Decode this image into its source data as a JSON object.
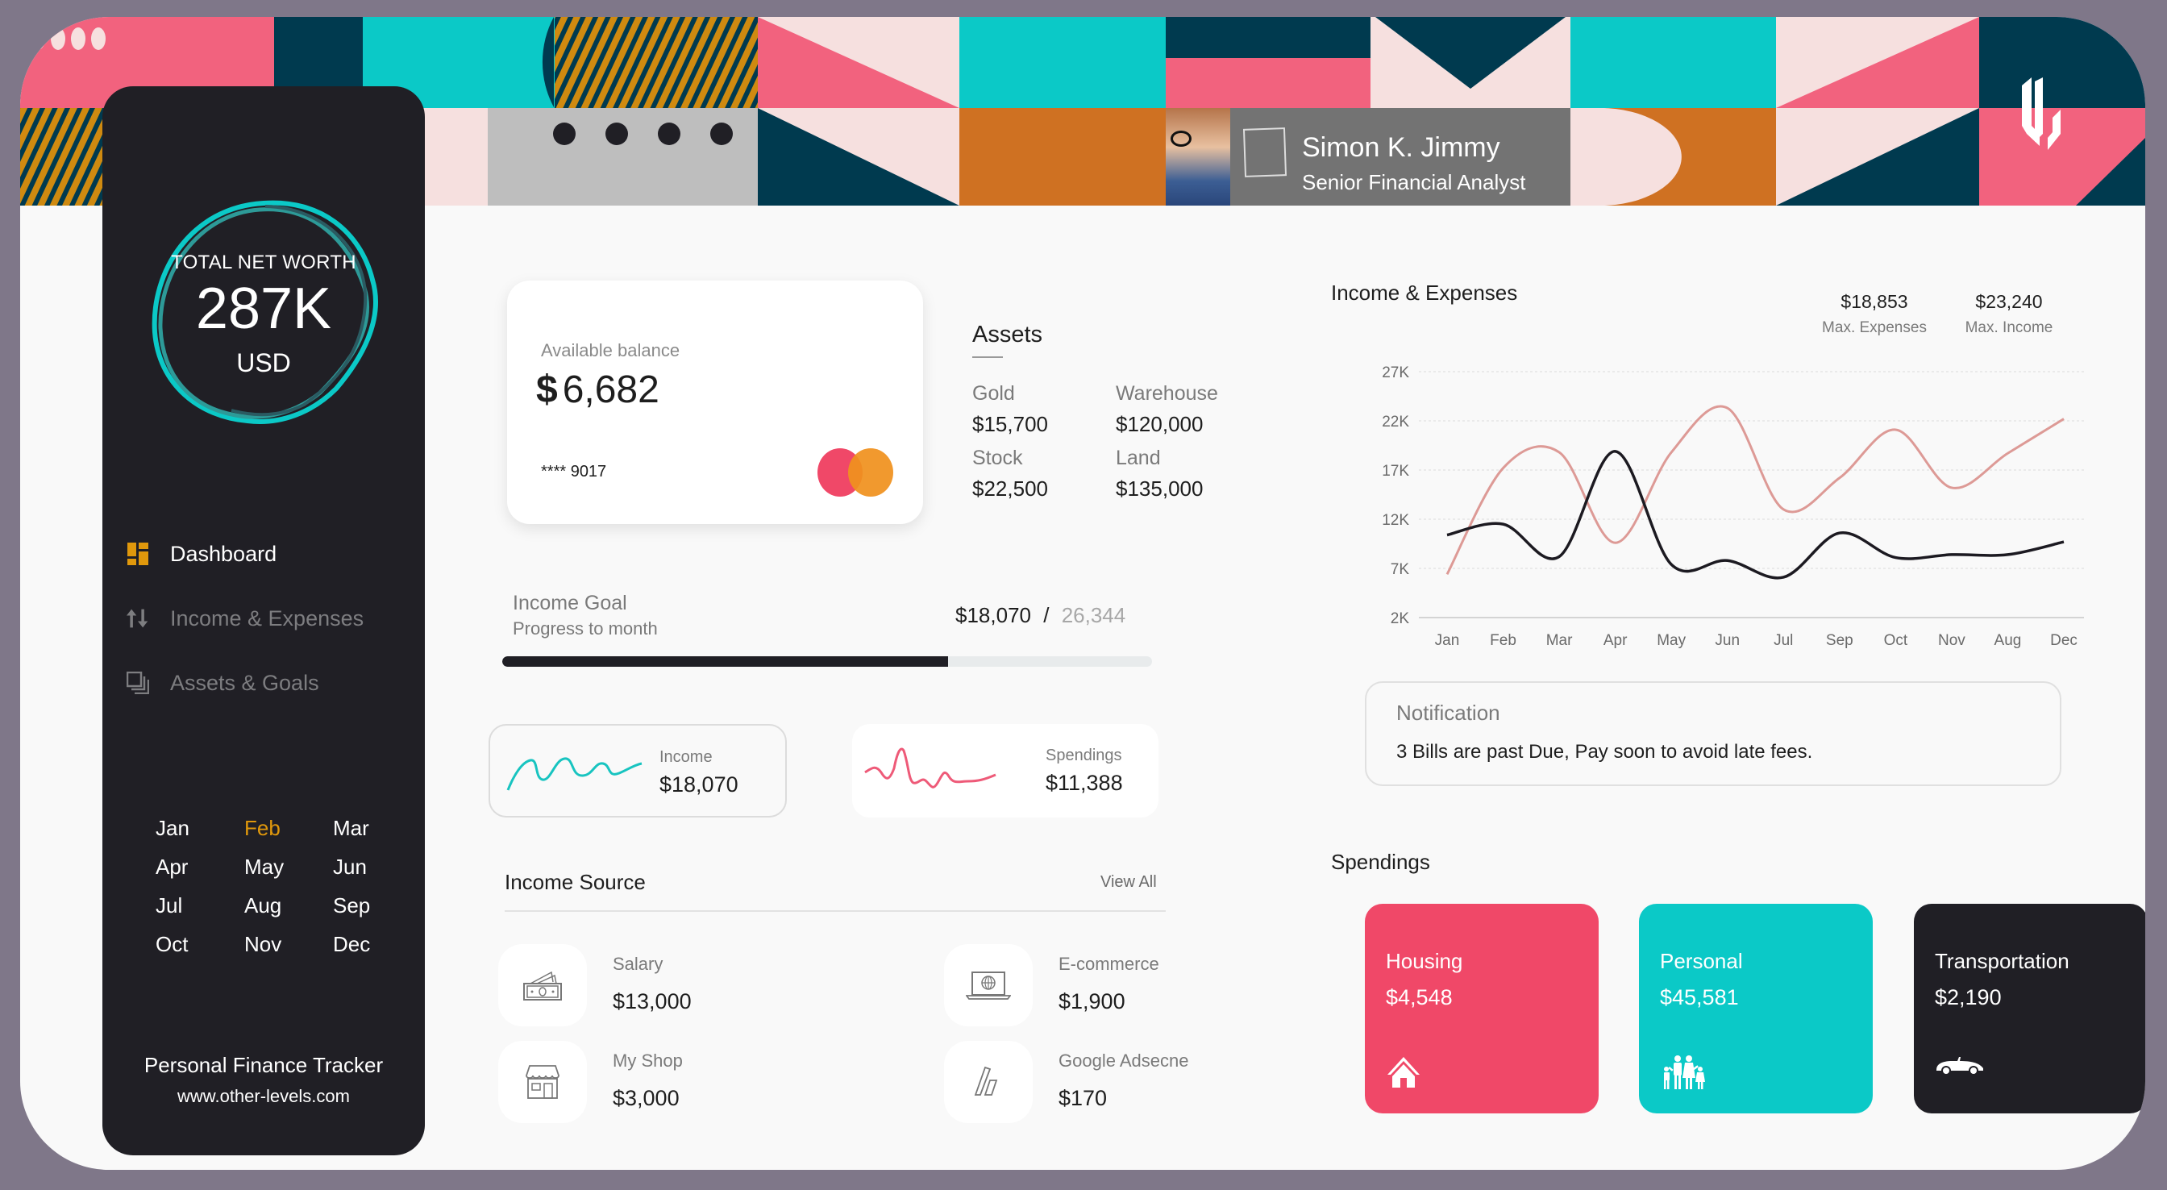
{
  "profile": {
    "name": "Simon K. Jimmy",
    "role": "Senior Financial Analyst"
  },
  "logo": "OL",
  "sidebar": {
    "networth": {
      "label": "TOTAL NET WORTH",
      "value": "287K",
      "unit": "USD"
    },
    "nav": [
      {
        "label": "Dashboard",
        "icon": "dashboard-icon",
        "active": true
      },
      {
        "label": "Income & Expenses",
        "icon": "up-down-arrows-icon",
        "active": false
      },
      {
        "label": "Assets & Goals",
        "icon": "stacked-squares-icon",
        "active": false
      }
    ],
    "months": [
      "Jan",
      "Feb",
      "Mar",
      "Apr",
      "May",
      "Jun",
      "Jul",
      "Aug",
      "Sep",
      "Oct",
      "Nov",
      "Dec"
    ],
    "active_month": "Feb",
    "brand_title": "Personal Finance Tracker",
    "brand_url": "www.other-levels.com"
  },
  "balance": {
    "label": "Available balance",
    "currency": "$",
    "amount": "6,682",
    "card_number": "**** 9017"
  },
  "assets": {
    "title": "Assets",
    "items": [
      {
        "label": "Gold",
        "value": "$15,700"
      },
      {
        "label": "Warehouse",
        "value": "$120,000"
      },
      {
        "label": "Stock",
        "value": "$22,500"
      },
      {
        "label": "Land",
        "value": "$135,000"
      }
    ]
  },
  "goal": {
    "title": "Income Goal",
    "subtitle": "Progress to month",
    "current": "$18,070",
    "separator": "/",
    "target": "26,344",
    "progress_fraction": 0.686
  },
  "mini_cards": {
    "income": {
      "label": "Income",
      "value": "$18,070",
      "color": "#18c4c0"
    },
    "spendings": {
      "label": "Spendings",
      "value": "$11,388",
      "color": "#ee5a78"
    }
  },
  "income_source": {
    "title": "Income Source",
    "view_all": "View All",
    "items": [
      {
        "label": "Salary",
        "value": "$13,000",
        "icon": "cash-icon"
      },
      {
        "label": "E-commerce",
        "value": "$1,900",
        "icon": "laptop-globe-icon"
      },
      {
        "label": "My Shop",
        "value": "$3,000",
        "icon": "storefront-icon"
      },
      {
        "label": "Google Adsecne",
        "value": "$170",
        "icon": "adsense-icon"
      }
    ]
  },
  "chart_summary": {
    "max_expenses": {
      "value": "$18,853",
      "label": "Max. Expenses"
    },
    "max_income": {
      "value": "$23,240",
      "label": "Max. Income"
    }
  },
  "chart_data": {
    "type": "line",
    "title": "Income & Expenses",
    "categories": [
      "Jan",
      "Feb",
      "Mar",
      "Apr",
      "May",
      "Jun",
      "Jul",
      "Sep",
      "Oct",
      "Nov",
      "Aug",
      "Dec"
    ],
    "yticks": [
      "27K",
      "22K",
      "17K",
      "12K",
      "7K",
      "2K"
    ],
    "ytick_values": [
      27,
      22,
      17,
      12,
      7,
      2
    ],
    "ylim": [
      2,
      27
    ],
    "yunit": "K",
    "grid": true,
    "series": [
      {
        "name": "Income",
        "color": "#dd9a96",
        "values": [
          6.4,
          17.2,
          18.8,
          9.6,
          18.8,
          23.3,
          13.0,
          16.2,
          21.1,
          15.2,
          18.7,
          22.2
        ]
      },
      {
        "name": "Expenses",
        "color": "#1c1a21",
        "values": [
          10.4,
          11.5,
          8.2,
          18.9,
          7.4,
          7.8,
          6.1,
          10.6,
          8.1,
          8.4,
          8.4,
          9.7
        ]
      }
    ]
  },
  "notification": {
    "title": "Notification",
    "message": "3 Bills are past Due, Pay soon to avoid late fees."
  },
  "spendings": {
    "title": "Spendings",
    "items": [
      {
        "label": "Housing",
        "value": "$4,548",
        "icon": "house-icon",
        "color": "#f04868"
      },
      {
        "label": "Personal",
        "value": "$45,581",
        "icon": "family-icon",
        "color": "#0bc9c7"
      },
      {
        "label": "Transportation",
        "value": "$2,190",
        "icon": "car-icon",
        "color": "#201f25"
      }
    ]
  },
  "colors": {
    "teal": "#0bc9c7",
    "navy": "#003a4f",
    "pink": "#f2627e",
    "blush": "#f6e0df",
    "orange": "#cf7122",
    "gold": "#e0980c",
    "sidebar": "#201f25"
  }
}
